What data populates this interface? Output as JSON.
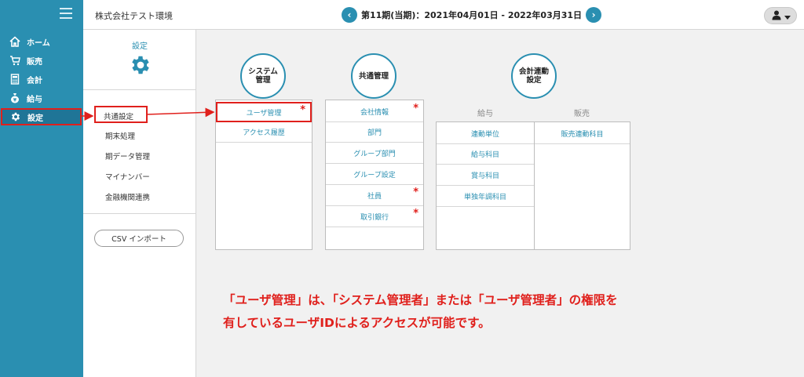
{
  "nav": {
    "items": [
      {
        "label": "ホーム",
        "icon": "home-icon"
      },
      {
        "label": "販売",
        "icon": "cart-icon"
      },
      {
        "label": "会計",
        "icon": "calculator-icon"
      },
      {
        "label": "給与",
        "icon": "money-bag-icon"
      },
      {
        "label": "設定",
        "icon": "gear-icon"
      }
    ]
  },
  "topbar": {
    "env_name": "株式会社テスト環境",
    "period": "第11期(当期)：2021年04月01日 - 2022年03月31日",
    "prev_symbol": "‹",
    "next_symbol": "›"
  },
  "settings": {
    "title": "設定",
    "items": [
      "共通設定",
      "期末処理",
      "期データ管理",
      "マイナンバー",
      "金融機関連携"
    ],
    "csv_button": "CSV インポート"
  },
  "groups": {
    "system": {
      "title_line1": "システム",
      "title_line2": "管理",
      "items": [
        "ユーザ管理",
        "アクセス履歴"
      ]
    },
    "common": {
      "title": "共通管理",
      "items": [
        "会社情報",
        "部門",
        "グループ部門",
        "グループ設定",
        "社員",
        "取引銀行"
      ]
    },
    "accounting_link": {
      "title_line1": "会計連動",
      "title_line2": "設定",
      "col_payroll": "給与",
      "col_sales": "販売",
      "payroll_items": [
        "連動単位",
        "給与科目",
        "賞与科目",
        "単独年調科目"
      ],
      "sales_items": [
        "販売連動科目"
      ]
    }
  },
  "star_mark": "*",
  "notice": {
    "line1": "「ユーザ管理」は、「システム管理者」または「ユーザ管理者」の権限を",
    "line2": "有しているユーザIDによるアクセスが可能です。"
  },
  "colors": {
    "accent": "#2a8fb1",
    "highlight": "#e0201c"
  }
}
